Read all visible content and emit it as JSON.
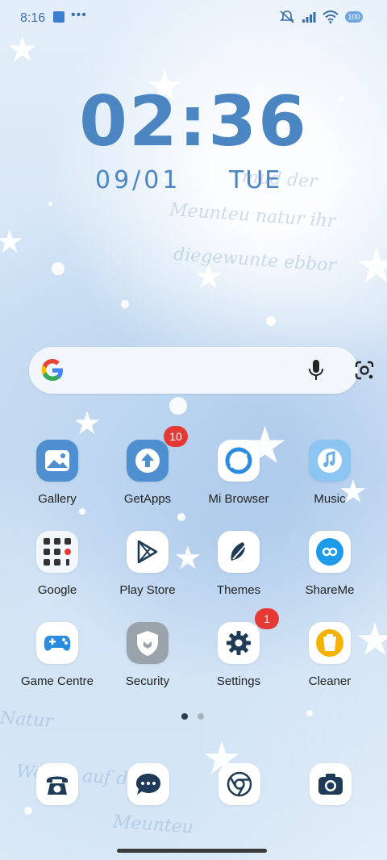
{
  "status_bar": {
    "time": "8:16",
    "more": "•••",
    "battery": "100"
  },
  "clock": {
    "time": "02:36",
    "date": "09/01",
    "day": "TUE"
  },
  "search": {
    "icons": [
      "google-g-icon",
      "microphone-icon",
      "google-lens-icon"
    ]
  },
  "apps": [
    {
      "label": "Gallery",
      "icon": "gallery-icon"
    },
    {
      "label": "GetApps",
      "icon": "getapps-icon",
      "badge": "10"
    },
    {
      "label": "Mi Browser",
      "icon": "mi-browser-icon"
    },
    {
      "label": "Music",
      "icon": "music-icon"
    },
    {
      "label": "Google",
      "icon": "google-folder-icon"
    },
    {
      "label": "Play Store",
      "icon": "play-store-icon"
    },
    {
      "label": "Themes",
      "icon": "themes-icon"
    },
    {
      "label": "ShareMe",
      "icon": "shareme-icon"
    },
    {
      "label": "Game Centre",
      "icon": "game-centre-icon"
    },
    {
      "label": "Security",
      "icon": "security-icon"
    },
    {
      "label": "Settings",
      "icon": "settings-icon",
      "badge": "1"
    },
    {
      "label": "Cleaner",
      "icon": "cleaner-icon"
    }
  ],
  "pager": {
    "pages": 2,
    "current": 1
  },
  "dock": [
    "phone-icon",
    "messages-icon",
    "chrome-icon",
    "camera-icon"
  ],
  "colors": {
    "clock": "#4c86c2",
    "badge": "#e53935"
  }
}
